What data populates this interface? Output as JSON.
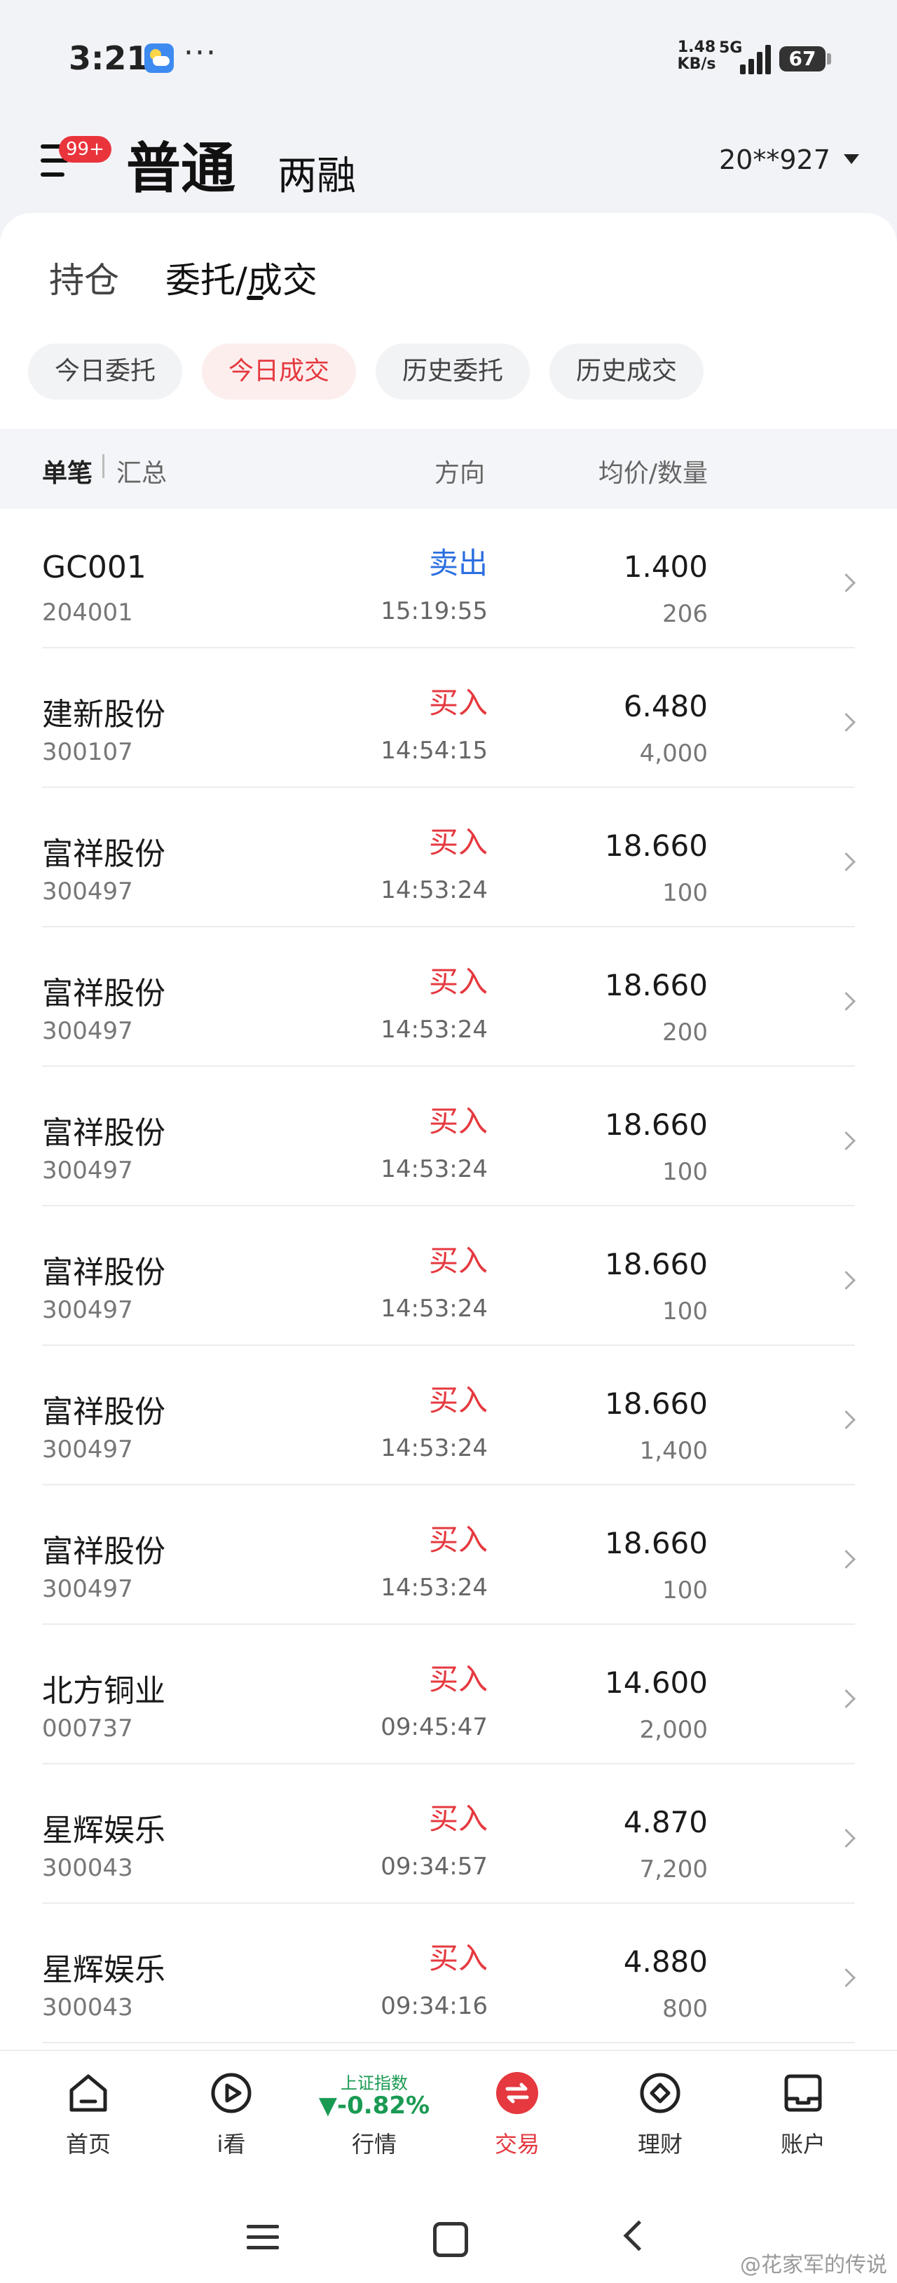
{
  "status": {
    "time": "3:21",
    "speed_value": "1.48",
    "speed_unit": "KB/s",
    "network": "5G",
    "battery": "67"
  },
  "header": {
    "badge": "99+",
    "tab_main": "普通",
    "tab_sub": "两融",
    "account": "20**927"
  },
  "subtabs": {
    "hold": "持仓",
    "order": "委托/成交"
  },
  "chips": [
    "今日委托",
    "今日成交",
    "历史委托",
    "历史成交"
  ],
  "columns": {
    "single": "单笔",
    "summary": "汇总",
    "direction": "方向",
    "price_qty": "均价/数量"
  },
  "trades": [
    {
      "name": "GC001",
      "code": "204001",
      "direction": "卖出",
      "side": "sell",
      "time": "15:19:55",
      "price": "1.400",
      "qty": "206"
    },
    {
      "name": "建新股份",
      "code": "300107",
      "direction": "买入",
      "side": "buy",
      "time": "14:54:15",
      "price": "6.480",
      "qty": "4,000"
    },
    {
      "name": "富祥股份",
      "code": "300497",
      "direction": "买入",
      "side": "buy",
      "time": "14:53:24",
      "price": "18.660",
      "qty": "100"
    },
    {
      "name": "富祥股份",
      "code": "300497",
      "direction": "买入",
      "side": "buy",
      "time": "14:53:24",
      "price": "18.660",
      "qty": "200"
    },
    {
      "name": "富祥股份",
      "code": "300497",
      "direction": "买入",
      "side": "buy",
      "time": "14:53:24",
      "price": "18.660",
      "qty": "100"
    },
    {
      "name": "富祥股份",
      "code": "300497",
      "direction": "买入",
      "side": "buy",
      "time": "14:53:24",
      "price": "18.660",
      "qty": "100"
    },
    {
      "name": "富祥股份",
      "code": "300497",
      "direction": "买入",
      "side": "buy",
      "time": "14:53:24",
      "price": "18.660",
      "qty": "1,400"
    },
    {
      "name": "富祥股份",
      "code": "300497",
      "direction": "买入",
      "side": "buy",
      "time": "14:53:24",
      "price": "18.660",
      "qty": "100"
    },
    {
      "name": "北方铜业",
      "code": "000737",
      "direction": "买入",
      "side": "buy",
      "time": "09:45:47",
      "price": "14.600",
      "qty": "2,000"
    },
    {
      "name": "星辉娱乐",
      "code": "300043",
      "direction": "买入",
      "side": "buy",
      "time": "09:34:57",
      "price": "4.870",
      "qty": "7,200"
    },
    {
      "name": "星辉娱乐",
      "code": "300043",
      "direction": "买入",
      "side": "buy",
      "time": "09:34:16",
      "price": "4.880",
      "qty": "800"
    }
  ],
  "nav": {
    "home": "首页",
    "watch": "i看",
    "market": "行情",
    "trade": "交易",
    "finance": "理财",
    "account": "账户",
    "index_name": "上证指数",
    "index_value": "▼-0.82%"
  },
  "watermark": "@花家军的传说",
  "colors": {
    "buy": "#e5393f",
    "sell": "#2b6fe0",
    "index_down": "#1a9a52"
  }
}
